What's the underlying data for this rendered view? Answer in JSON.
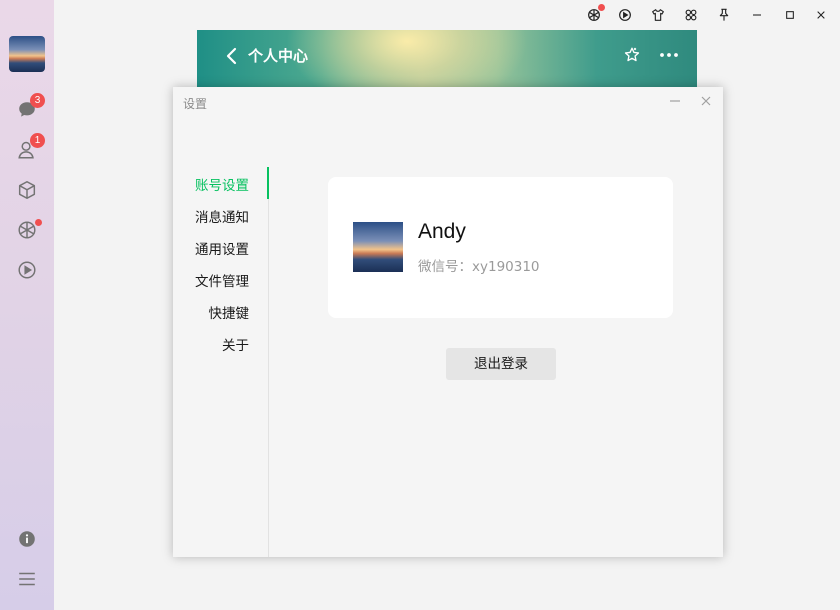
{
  "window": {
    "profile_header_title": "个人中心"
  },
  "sidebar": {
    "chat_badge": "3",
    "contacts_badge": "1"
  },
  "settings_dialog": {
    "title": "设置",
    "nav_items": [
      {
        "label": "账号设置",
        "active": true
      },
      {
        "label": "消息通知",
        "active": false
      },
      {
        "label": "通用设置",
        "active": false
      },
      {
        "label": "文件管理",
        "active": false
      },
      {
        "label": "快捷键",
        "active": false
      },
      {
        "label": "关于",
        "active": false
      }
    ],
    "account": {
      "name": "Andy",
      "wechat_id": "微信号：xy190310"
    },
    "logout_label": "退出登录"
  },
  "icons": {
    "titlebar": [
      "moments-icon",
      "channels-icon",
      "shirt-icon",
      "mini-programs-icon",
      "pin-icon",
      "minimize-icon",
      "maximize-icon",
      "close-icon"
    ],
    "sidebar": [
      "chat-icon",
      "contacts-icon",
      "box-icon",
      "moments-icon",
      "channels-icon",
      "info-icon",
      "menu-icon"
    ]
  },
  "colors": {
    "accent": "#07c160",
    "badge": "#f04f4f"
  }
}
